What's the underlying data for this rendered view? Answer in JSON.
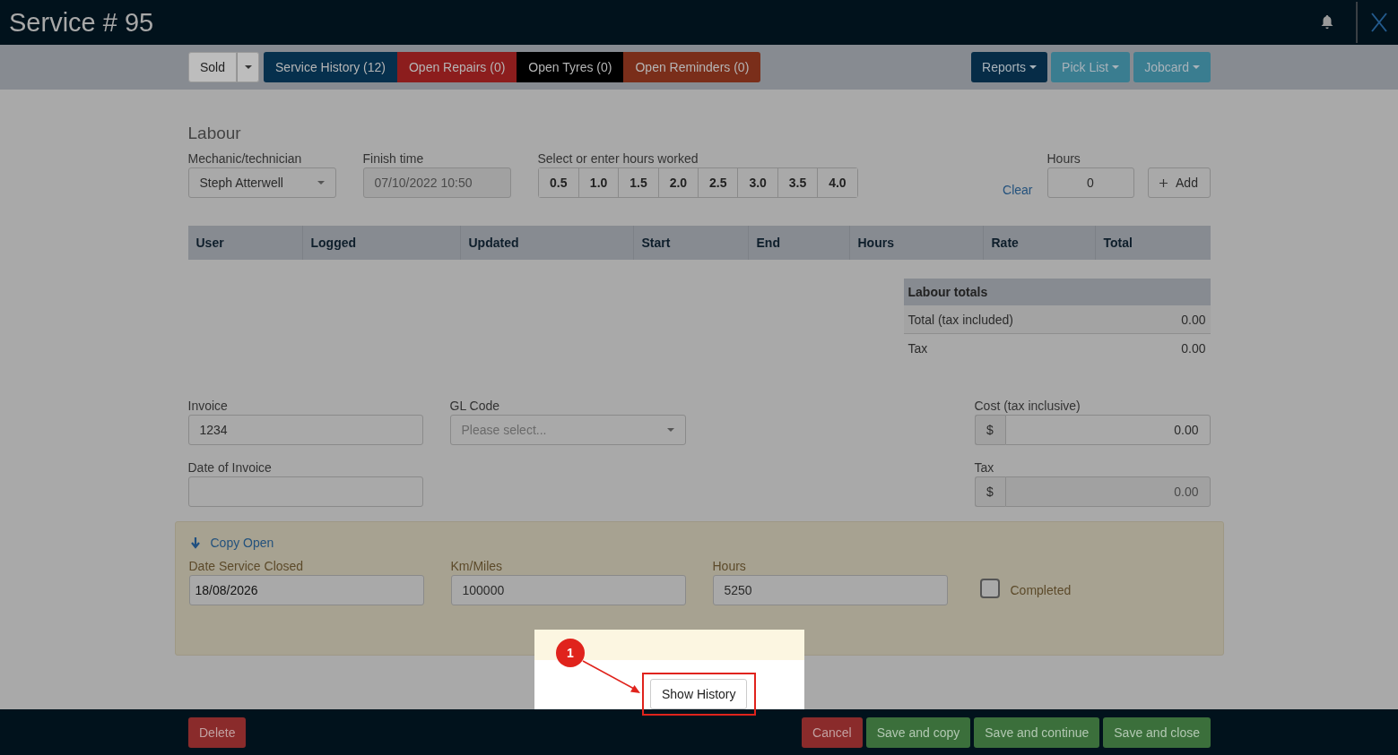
{
  "header": {
    "title": "Service # 95"
  },
  "toolbar": {
    "status_button": "Sold",
    "tabs": [
      {
        "label": "Service History (12)",
        "color": "#06304d"
      },
      {
        "label": "Open Repairs (0)",
        "color": "#8c1d1d"
      },
      {
        "label": "Open Tyres (0)",
        "color": "#000000"
      },
      {
        "label": "Open Reminders (0)",
        "color": "#7a2e1a"
      }
    ],
    "menus": [
      {
        "label": "Reports",
        "color": "#062c47"
      },
      {
        "label": "Pick List",
        "color": "#3a7d90"
      },
      {
        "label": "Jobcard",
        "color": "#3a7d90"
      }
    ]
  },
  "labour": {
    "title": "Labour",
    "mechanic": {
      "label": "Mechanic/technician",
      "value": "Steph Atterwell"
    },
    "finish_time": {
      "label": "Finish time",
      "value": "07/10/2022 10:50",
      "disabled": true
    },
    "hours_worked": {
      "label": "Select or enter hours worked",
      "options": [
        "0.5",
        "1.0",
        "1.5",
        "2.0",
        "2.5",
        "3.0",
        "3.5",
        "4.0"
      ]
    },
    "clear_link": "Clear",
    "hours": {
      "label": "Hours",
      "value": "0"
    },
    "add_button": "Add",
    "table": {
      "columns": [
        "User",
        "Logged",
        "Updated",
        "Start",
        "End",
        "Hours",
        "Rate",
        "Total"
      ]
    },
    "totals": {
      "title": "Labour totals",
      "rows": [
        {
          "label": "Total (tax included)",
          "value": "0.00"
        },
        {
          "label": "Tax",
          "value": "0.00"
        }
      ]
    }
  },
  "invoice": {
    "invoice": {
      "label": "Invoice",
      "value": "1234"
    },
    "gl_code": {
      "label": "GL Code",
      "placeholder": "Please select..."
    },
    "cost": {
      "label": "Cost (tax inclusive)",
      "prefix": "$",
      "value": "0.00",
      "disabled": false
    },
    "date_of_invoice": {
      "label": "Date of Invoice"
    },
    "tax": {
      "label": "Tax",
      "prefix": "$",
      "value": "0.00",
      "disabled": true
    }
  },
  "close_panel": {
    "copy_link": "Copy Open",
    "fields": [
      {
        "label": "Date Service Closed",
        "value": "18/08/2026"
      },
      {
        "label": "Km/Miles",
        "value": "100000"
      },
      {
        "label": "Hours",
        "value": "5250"
      }
    ],
    "completed": {
      "label": "Completed",
      "checked": false
    }
  },
  "show_history_button": "Show History",
  "annotation": {
    "marker": "1"
  },
  "footer": {
    "delete_button": "Delete",
    "cancel_button": "Cancel",
    "save_buttons": [
      "Save and copy",
      "Save and continue",
      "Save and close"
    ]
  }
}
